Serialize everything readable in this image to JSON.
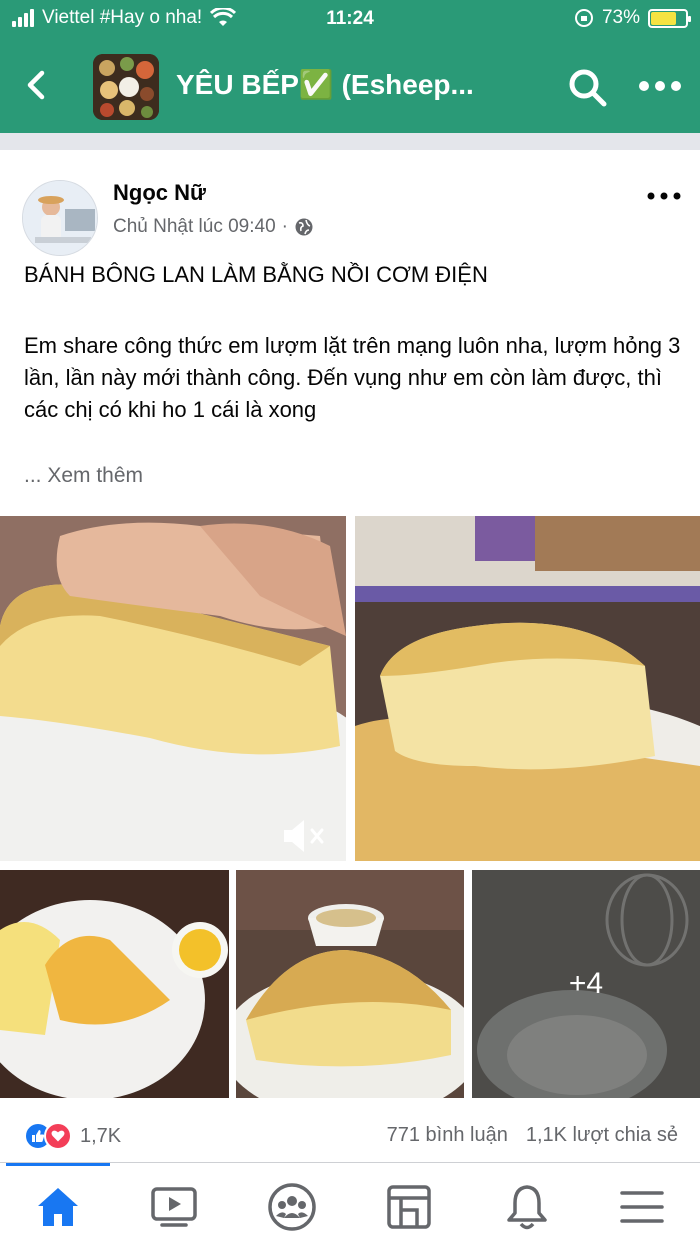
{
  "status_bar": {
    "carrier": "Viettel #Hay o nha!",
    "time": "11:24",
    "battery": "73%",
    "battery_level": 0.73
  },
  "header": {
    "group_name": "YÊU BẾP✅ (Esheep...",
    "back_icon": "chevron-left-icon",
    "search_icon": "search-icon",
    "more_icon": "more-horizontal-icon"
  },
  "post": {
    "author": "Ngọc Nữ",
    "timestamp": "Chủ Nhật lúc 09:40",
    "meta_separator": "·",
    "privacy_icon": "globe-icon",
    "title": "BÁNH BÔNG LAN LÀM BẰNG NỒI CƠM ĐIỆN",
    "body": "Em share công thức em lượm lặt trên mạng luôn nha, lượm hỏng 3 lần, lần này mới thành công. Đến vụng như em còn làm được, thì các chị có khi ho 1 cái là xong",
    "see_more": "... Xem thêm",
    "more_photos": "+4",
    "reaction_count": "1,7K",
    "comments": "771 bình luận",
    "shares": "1,1K lượt chia sẻ"
  },
  "tabs": [
    "home-icon",
    "watch-icon",
    "groups-icon",
    "marketplace-icon",
    "notifications-icon",
    "menu-icon"
  ],
  "colors": {
    "header_green": "#2a9a77",
    "facebook_blue": "#1877f2",
    "love_red": "#f33e58",
    "secondary_text": "#65676b"
  }
}
